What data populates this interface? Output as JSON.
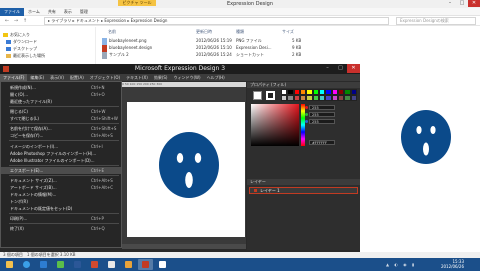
{
  "explorer": {
    "title": "Expression Design",
    "context_tab": "ピクチャ ツール",
    "ribbon_tabs": [
      "ファイル",
      "ホーム",
      "共有",
      "表示",
      "管理"
    ],
    "address": "▸ ライブラリ ▸ ドキュメント ▸ Expression ▸ Expression Design",
    "search_placeholder": "Expression Designの検索",
    "nav": [
      "お気に入り",
      "ダウンロード",
      "デスクトップ",
      "最近表示した場所"
    ],
    "columns": [
      "名前",
      "更新日時",
      "種類",
      "サイズ"
    ],
    "files": [
      {
        "name": "bluebayleneet.png",
        "date": "2012/06/26 15:19",
        "type": "PNG ファイル",
        "size": "5 KB"
      },
      {
        "name": "bluebayleneet.design",
        "date": "2012/06/26 15:10",
        "type": "Expression Desi...",
        "size": "9 KB"
      },
      {
        "name": "サンプル 2",
        "date": "2012/06/26 15:24",
        "type": "ショートカット",
        "size": "2 KB"
      }
    ],
    "status": "3 個の項目　1 個の項目を選択 3.10 KB"
  },
  "design": {
    "title": "Microsoft Expression Design 3",
    "menus": [
      "ファイル(F)",
      "編集(E)",
      "表示(V)",
      "配置(A)",
      "オブジェクト(O)",
      "テキスト(X)",
      "効果(S)",
      "ウィンドウ(W)",
      "ヘルプ(H)"
    ],
    "ruler": "0    50    100    150    200    250    300",
    "file_menu": [
      {
        "label": "新規作成(N)...",
        "shortcut": "Ctrl+N"
      },
      {
        "label": "開く(O)...",
        "shortcut": "Ctrl+O"
      },
      {
        "label": "最近使ったファイル(R)",
        "shortcut": ""
      },
      {
        "label": "閉じる(C)",
        "shortcut": "Ctrl+W"
      },
      {
        "label": "すべて閉じる(L)",
        "shortcut": "Ctrl+Shift+W"
      },
      {
        "label": "名前を付けて保存(A)...",
        "shortcut": "Ctrl+Shift+S"
      },
      {
        "label": "コピーを保存(Y)...",
        "shortcut": "Ctrl+Alt+S"
      },
      {
        "label": "イメージのインポート(I)...",
        "shortcut": "Ctrl+I"
      },
      {
        "label": "Adobe Photoshop ファイルのインポート(H)...",
        "shortcut": ""
      },
      {
        "label": "Adobe Illustrator ファイルのインポート(D)...",
        "shortcut": ""
      },
      {
        "label": "エクスポート(E)...",
        "shortcut": "Ctrl+E"
      },
      {
        "label": "ドキュメント サイズ(Z)...",
        "shortcut": "Ctrl+Alt+S"
      },
      {
        "label": "アートボード サイズ(B)...",
        "shortcut": "Ctrl+Alt+C"
      },
      {
        "label": "ドキュメントの情報(M)...",
        "shortcut": ""
      },
      {
        "label": "トンボ(R)",
        "shortcut": ""
      },
      {
        "label": "ドキュメントの既定値をセット(D)",
        "shortcut": ""
      },
      {
        "label": "印刷(P)...",
        "shortcut": "Ctrl+P"
      },
      {
        "label": "終了(X)",
        "shortcut": "Ctrl+Q"
      }
    ],
    "properties_title": "プロパティ (フィル)",
    "color_values": {
      "r": "255",
      "g": "255",
      "b": "255",
      "hex": "#FFFFFF"
    },
    "layers_title": "レイヤー",
    "layer_name": "レイヤー 1"
  },
  "taskbar": {
    "time": "15:33",
    "date": "2012/06/26"
  },
  "colors": {
    "face_blue": "#0b4a8a",
    "accent_red": "#c23b22",
    "taskbar": "#1b4f8a"
  }
}
